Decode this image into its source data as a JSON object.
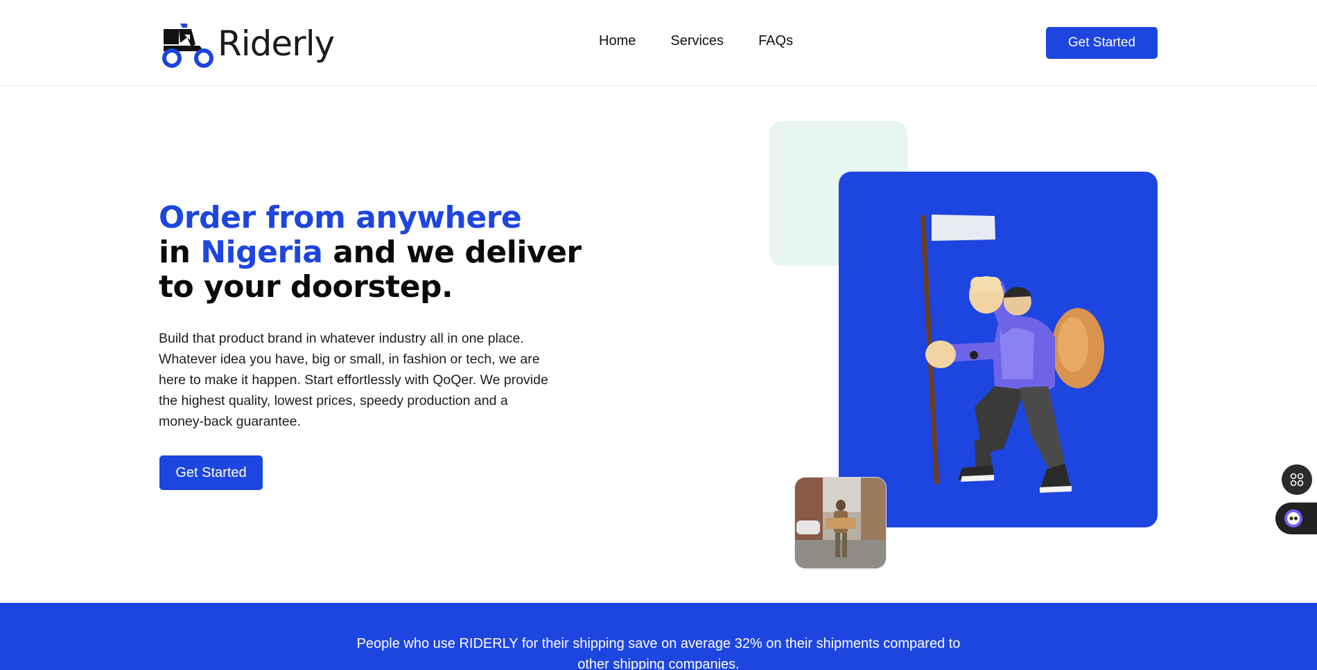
{
  "brand": {
    "name": "Riderly",
    "accent": "#1d45e0",
    "logo_icon": "scooter-rider-icon"
  },
  "nav": {
    "links": [
      {
        "label": "Home"
      },
      {
        "label": "Services"
      },
      {
        "label": "FAQs"
      }
    ],
    "cta_label": "Get Started"
  },
  "hero": {
    "title": {
      "line1": "Order from anywhere",
      "line2_pre": "in ",
      "line2_accent": "Nigeria",
      "line2_post": " and we deliver",
      "line3": "to your doorstep."
    },
    "description": "Build that product brand in whatever industry all in one place. Whatever idea you have, big or small, in fashion or tech, we are here to make it happen. Start effortlessly with QoQer. We provide the highest quality, lowest prices, speedy production and a money-back guarantee.",
    "cta_label": "Get Started",
    "illustration_icon": "traveler-with-flag-illustration",
    "photo_icon": "delivery-man-photo"
  },
  "side_widgets": [
    {
      "icon": "apps-grid-icon"
    },
    {
      "icon": "assistant-eye-icon"
    }
  ],
  "stats": {
    "text": "People who use RIDERLY for their shipping save on average 32% on their shipments compared to other shipping companies."
  }
}
